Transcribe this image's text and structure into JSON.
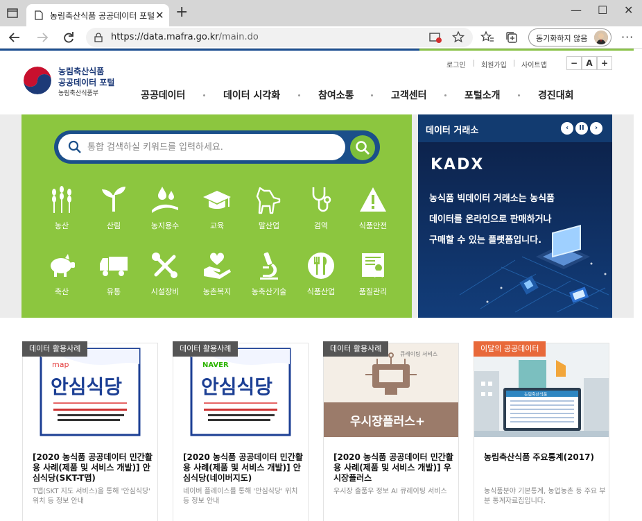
{
  "browser": {
    "tab_title": "농림축산식품 공공데이터 포털",
    "tab_close": "✕",
    "new_tab": "+",
    "window_controls": [
      "—",
      "☐",
      "✕"
    ],
    "url_host": "https://data.mafra.go.kr",
    "url_path": "/main.do",
    "sync_label": "동기화하지 않음",
    "more_label": "···"
  },
  "header": {
    "logo_line1": "농림축산식품",
    "logo_line2": "공공데이터 포털",
    "logo_line3": "농림축산식품부",
    "util_links": [
      "로그인",
      "회원가입",
      "사이트맵"
    ],
    "font_buttons": [
      "−",
      "A",
      "+"
    ],
    "gnb": [
      "공공데이터",
      "데이터 시각화",
      "참여소통",
      "고객센터",
      "포털소개",
      "경진대회"
    ]
  },
  "search": {
    "placeholder": "통합 검색하실 키워드를 입력하세요."
  },
  "categories_row1": [
    "농산",
    "산림",
    "농지용수",
    "교육",
    "말산업",
    "검역",
    "식품안전"
  ],
  "categories_row2": [
    "축산",
    "유통",
    "시설장비",
    "농촌복지",
    "농축산기술",
    "식품산업",
    "품질관리"
  ],
  "data_exchange": {
    "title": "데이터 거래소",
    "prev": "‹",
    "pause": "II",
    "next": "›",
    "brand": "KADX",
    "lines": [
      "농식품 빅데이터 거래소는 농식품",
      "데이터를 온라인으로 판매하거나",
      "구매할 수 있는 플랫폼입니다."
    ]
  },
  "cards": [
    {
      "badge": "데이터 활용사례",
      "title": "[2020 농식품 공공데이터 민간활용 사례(제품 및 서비스 개발)] 안심식당(SKT-T맵)",
      "desc": "T맵(SKT 지도 서비스)을 통해 '안심식당' 위치 등 정보 안내",
      "thumb_brand": "map",
      "thumb_text": "안심식당"
    },
    {
      "badge": "데이터 활용사례",
      "title": "[2020 농식품 공공데이터 민간활용 사례(제품 및 서비스 개발)] 안심식당(네이버지도)",
      "desc": "네이버 플레이스를 통해 '안심식당' 위치 등 정보 안내",
      "thumb_brand": "NAVER",
      "thumb_text": "안심식당"
    },
    {
      "badge": "데이터 활용사례",
      "title": "[2020 농식품 공공데이터 민간활용 사례(제품 및 서비스 개발)] 우시장플러스",
      "desc": "우시장 출품우 정보 AI 큐레이팅 서비스",
      "thumb_caption": "큐레이팅 서비스",
      "thumb_text": "우시장플러스+"
    },
    {
      "badge": "이달의 공공데이터",
      "title": "농림축산식품 주요통계(2017)",
      "desc": "농식품분야 기본통계, 농업농촌 등 주요 부분 통계자료집입니다.",
      "thumb_text": "농림축산식품"
    }
  ],
  "colors": {
    "navy": "#1b4f8a",
    "green": "#8cc63f",
    "badge_gray": "#555555",
    "badge_orange": "#e8693a"
  }
}
